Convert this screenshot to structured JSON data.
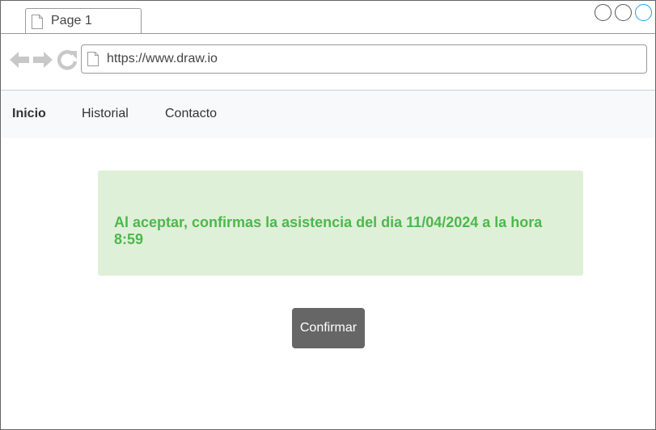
{
  "browser": {
    "tab_title": "Page 1",
    "url": "https://www.draw.io"
  },
  "nav": {
    "items": [
      {
        "label": "Inicio",
        "active": true
      },
      {
        "label": "Historial",
        "active": false
      },
      {
        "label": "Contacto",
        "active": false
      }
    ]
  },
  "alert": {
    "message": "Al aceptar, confirmas la asistencia del dia 11/04/2024 a la hora 8:59"
  },
  "actions": {
    "confirm_label": "Confirmar"
  },
  "colors": {
    "alert_background": "#dff0d8",
    "alert_text": "#4cb84c",
    "button_background": "#666666",
    "navbar_background": "#f8f9fa"
  },
  "icons": [
    "page-icon",
    "back-arrow-icon",
    "forward-arrow-icon",
    "reload-icon",
    "window-control-icon"
  ]
}
